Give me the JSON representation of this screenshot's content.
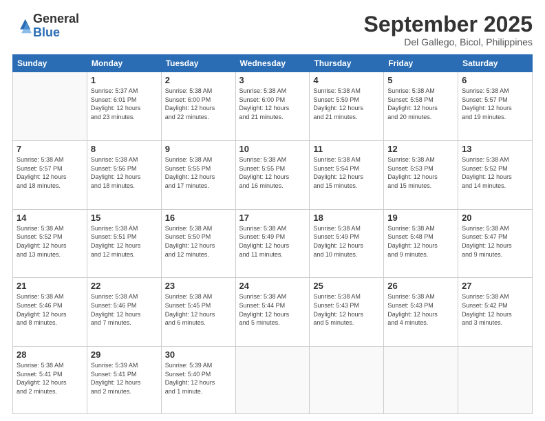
{
  "logo": {
    "general": "General",
    "blue": "Blue"
  },
  "title": "September 2025",
  "subtitle": "Del Gallego, Bicol, Philippines",
  "weekdays": [
    "Sunday",
    "Monday",
    "Tuesday",
    "Wednesday",
    "Thursday",
    "Friday",
    "Saturday"
  ],
  "days": [
    {
      "num": "",
      "info": ""
    },
    {
      "num": "1",
      "info": "Sunrise: 5:37 AM\nSunset: 6:01 PM\nDaylight: 12 hours\nand 23 minutes."
    },
    {
      "num": "2",
      "info": "Sunrise: 5:38 AM\nSunset: 6:00 PM\nDaylight: 12 hours\nand 22 minutes."
    },
    {
      "num": "3",
      "info": "Sunrise: 5:38 AM\nSunset: 6:00 PM\nDaylight: 12 hours\nand 21 minutes."
    },
    {
      "num": "4",
      "info": "Sunrise: 5:38 AM\nSunset: 5:59 PM\nDaylight: 12 hours\nand 21 minutes."
    },
    {
      "num": "5",
      "info": "Sunrise: 5:38 AM\nSunset: 5:58 PM\nDaylight: 12 hours\nand 20 minutes."
    },
    {
      "num": "6",
      "info": "Sunrise: 5:38 AM\nSunset: 5:57 PM\nDaylight: 12 hours\nand 19 minutes."
    },
    {
      "num": "7",
      "info": "Sunrise: 5:38 AM\nSunset: 5:57 PM\nDaylight: 12 hours\nand 18 minutes."
    },
    {
      "num": "8",
      "info": "Sunrise: 5:38 AM\nSunset: 5:56 PM\nDaylight: 12 hours\nand 18 minutes."
    },
    {
      "num": "9",
      "info": "Sunrise: 5:38 AM\nSunset: 5:55 PM\nDaylight: 12 hours\nand 17 minutes."
    },
    {
      "num": "10",
      "info": "Sunrise: 5:38 AM\nSunset: 5:55 PM\nDaylight: 12 hours\nand 16 minutes."
    },
    {
      "num": "11",
      "info": "Sunrise: 5:38 AM\nSunset: 5:54 PM\nDaylight: 12 hours\nand 15 minutes."
    },
    {
      "num": "12",
      "info": "Sunrise: 5:38 AM\nSunset: 5:53 PM\nDaylight: 12 hours\nand 15 minutes."
    },
    {
      "num": "13",
      "info": "Sunrise: 5:38 AM\nSunset: 5:52 PM\nDaylight: 12 hours\nand 14 minutes."
    },
    {
      "num": "14",
      "info": "Sunrise: 5:38 AM\nSunset: 5:52 PM\nDaylight: 12 hours\nand 13 minutes."
    },
    {
      "num": "15",
      "info": "Sunrise: 5:38 AM\nSunset: 5:51 PM\nDaylight: 12 hours\nand 12 minutes."
    },
    {
      "num": "16",
      "info": "Sunrise: 5:38 AM\nSunset: 5:50 PM\nDaylight: 12 hours\nand 12 minutes."
    },
    {
      "num": "17",
      "info": "Sunrise: 5:38 AM\nSunset: 5:49 PM\nDaylight: 12 hours\nand 11 minutes."
    },
    {
      "num": "18",
      "info": "Sunrise: 5:38 AM\nSunset: 5:49 PM\nDaylight: 12 hours\nand 10 minutes."
    },
    {
      "num": "19",
      "info": "Sunrise: 5:38 AM\nSunset: 5:48 PM\nDaylight: 12 hours\nand 9 minutes."
    },
    {
      "num": "20",
      "info": "Sunrise: 5:38 AM\nSunset: 5:47 PM\nDaylight: 12 hours\nand 9 minutes."
    },
    {
      "num": "21",
      "info": "Sunrise: 5:38 AM\nSunset: 5:46 PM\nDaylight: 12 hours\nand 8 minutes."
    },
    {
      "num": "22",
      "info": "Sunrise: 5:38 AM\nSunset: 5:46 PM\nDaylight: 12 hours\nand 7 minutes."
    },
    {
      "num": "23",
      "info": "Sunrise: 5:38 AM\nSunset: 5:45 PM\nDaylight: 12 hours\nand 6 minutes."
    },
    {
      "num": "24",
      "info": "Sunrise: 5:38 AM\nSunset: 5:44 PM\nDaylight: 12 hours\nand 5 minutes."
    },
    {
      "num": "25",
      "info": "Sunrise: 5:38 AM\nSunset: 5:43 PM\nDaylight: 12 hours\nand 5 minutes."
    },
    {
      "num": "26",
      "info": "Sunrise: 5:38 AM\nSunset: 5:43 PM\nDaylight: 12 hours\nand 4 minutes."
    },
    {
      "num": "27",
      "info": "Sunrise: 5:38 AM\nSunset: 5:42 PM\nDaylight: 12 hours\nand 3 minutes."
    },
    {
      "num": "28",
      "info": "Sunrise: 5:38 AM\nSunset: 5:41 PM\nDaylight: 12 hours\nand 2 minutes."
    },
    {
      "num": "29",
      "info": "Sunrise: 5:39 AM\nSunset: 5:41 PM\nDaylight: 12 hours\nand 2 minutes."
    },
    {
      "num": "30",
      "info": "Sunrise: 5:39 AM\nSunset: 5:40 PM\nDaylight: 12 hours\nand 1 minute."
    },
    {
      "num": "",
      "info": ""
    },
    {
      "num": "",
      "info": ""
    },
    {
      "num": "",
      "info": ""
    },
    {
      "num": "",
      "info": ""
    }
  ]
}
